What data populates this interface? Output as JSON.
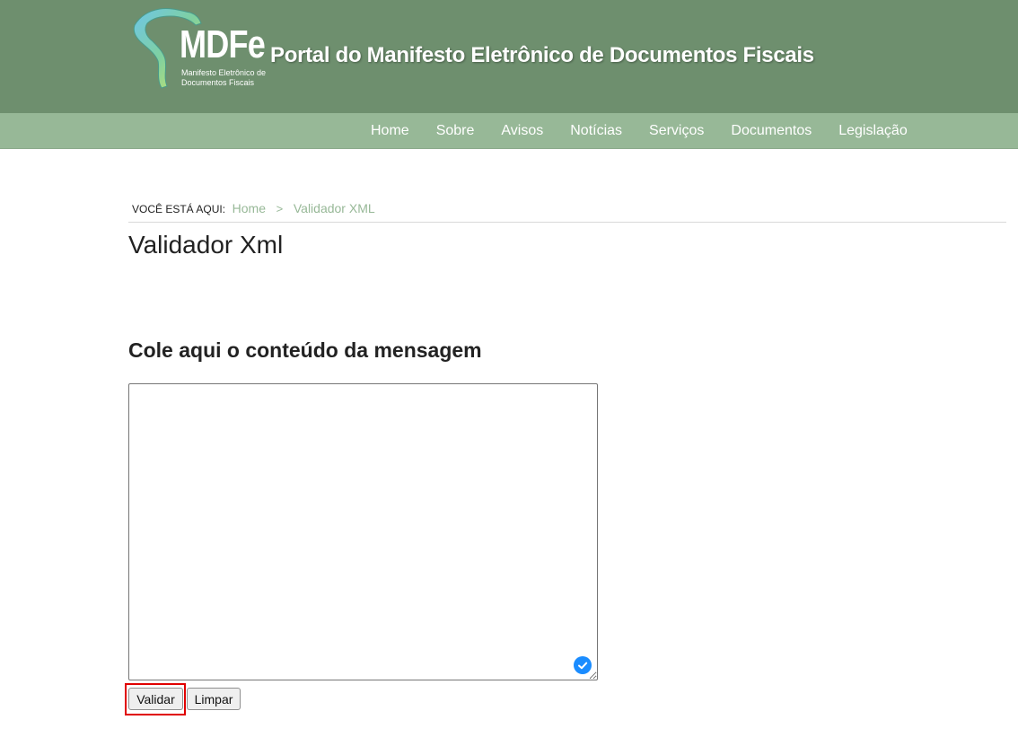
{
  "header": {
    "logo_text": "MDFe",
    "logo_subtitle": "Manifesto Eletrônico de Documentos Fiscais",
    "title": "Portal do Manifesto Eletrônico de Documentos Fiscais"
  },
  "nav": {
    "items": [
      {
        "label": "Home"
      },
      {
        "label": "Sobre"
      },
      {
        "label": "Avisos"
      },
      {
        "label": "Notícias"
      },
      {
        "label": "Serviços"
      },
      {
        "label": "Documentos"
      },
      {
        "label": "Legislação"
      }
    ]
  },
  "breadcrumb": {
    "lead": "VOCÊ ESTÁ AQUI:",
    "items": [
      {
        "label": "Home"
      },
      {
        "label": "Validador XML"
      }
    ],
    "separator": ">"
  },
  "page": {
    "title": "Validador Xml",
    "section_heading": "Cole aqui o conteúdo da mensagem",
    "xml_input": {
      "value": "",
      "placeholder": ""
    }
  },
  "buttons": {
    "validate_label": "Validar",
    "clear_label": "Limpar"
  },
  "colors": {
    "header_bg": "#6e8f6e",
    "nav_bg": "#97b897",
    "link": "#97b897",
    "highlight": "#e00000",
    "check_badge": "#1a8cff"
  },
  "icons": {
    "logo": "brazil-map-logo",
    "textarea_status": "check-circle-icon"
  }
}
